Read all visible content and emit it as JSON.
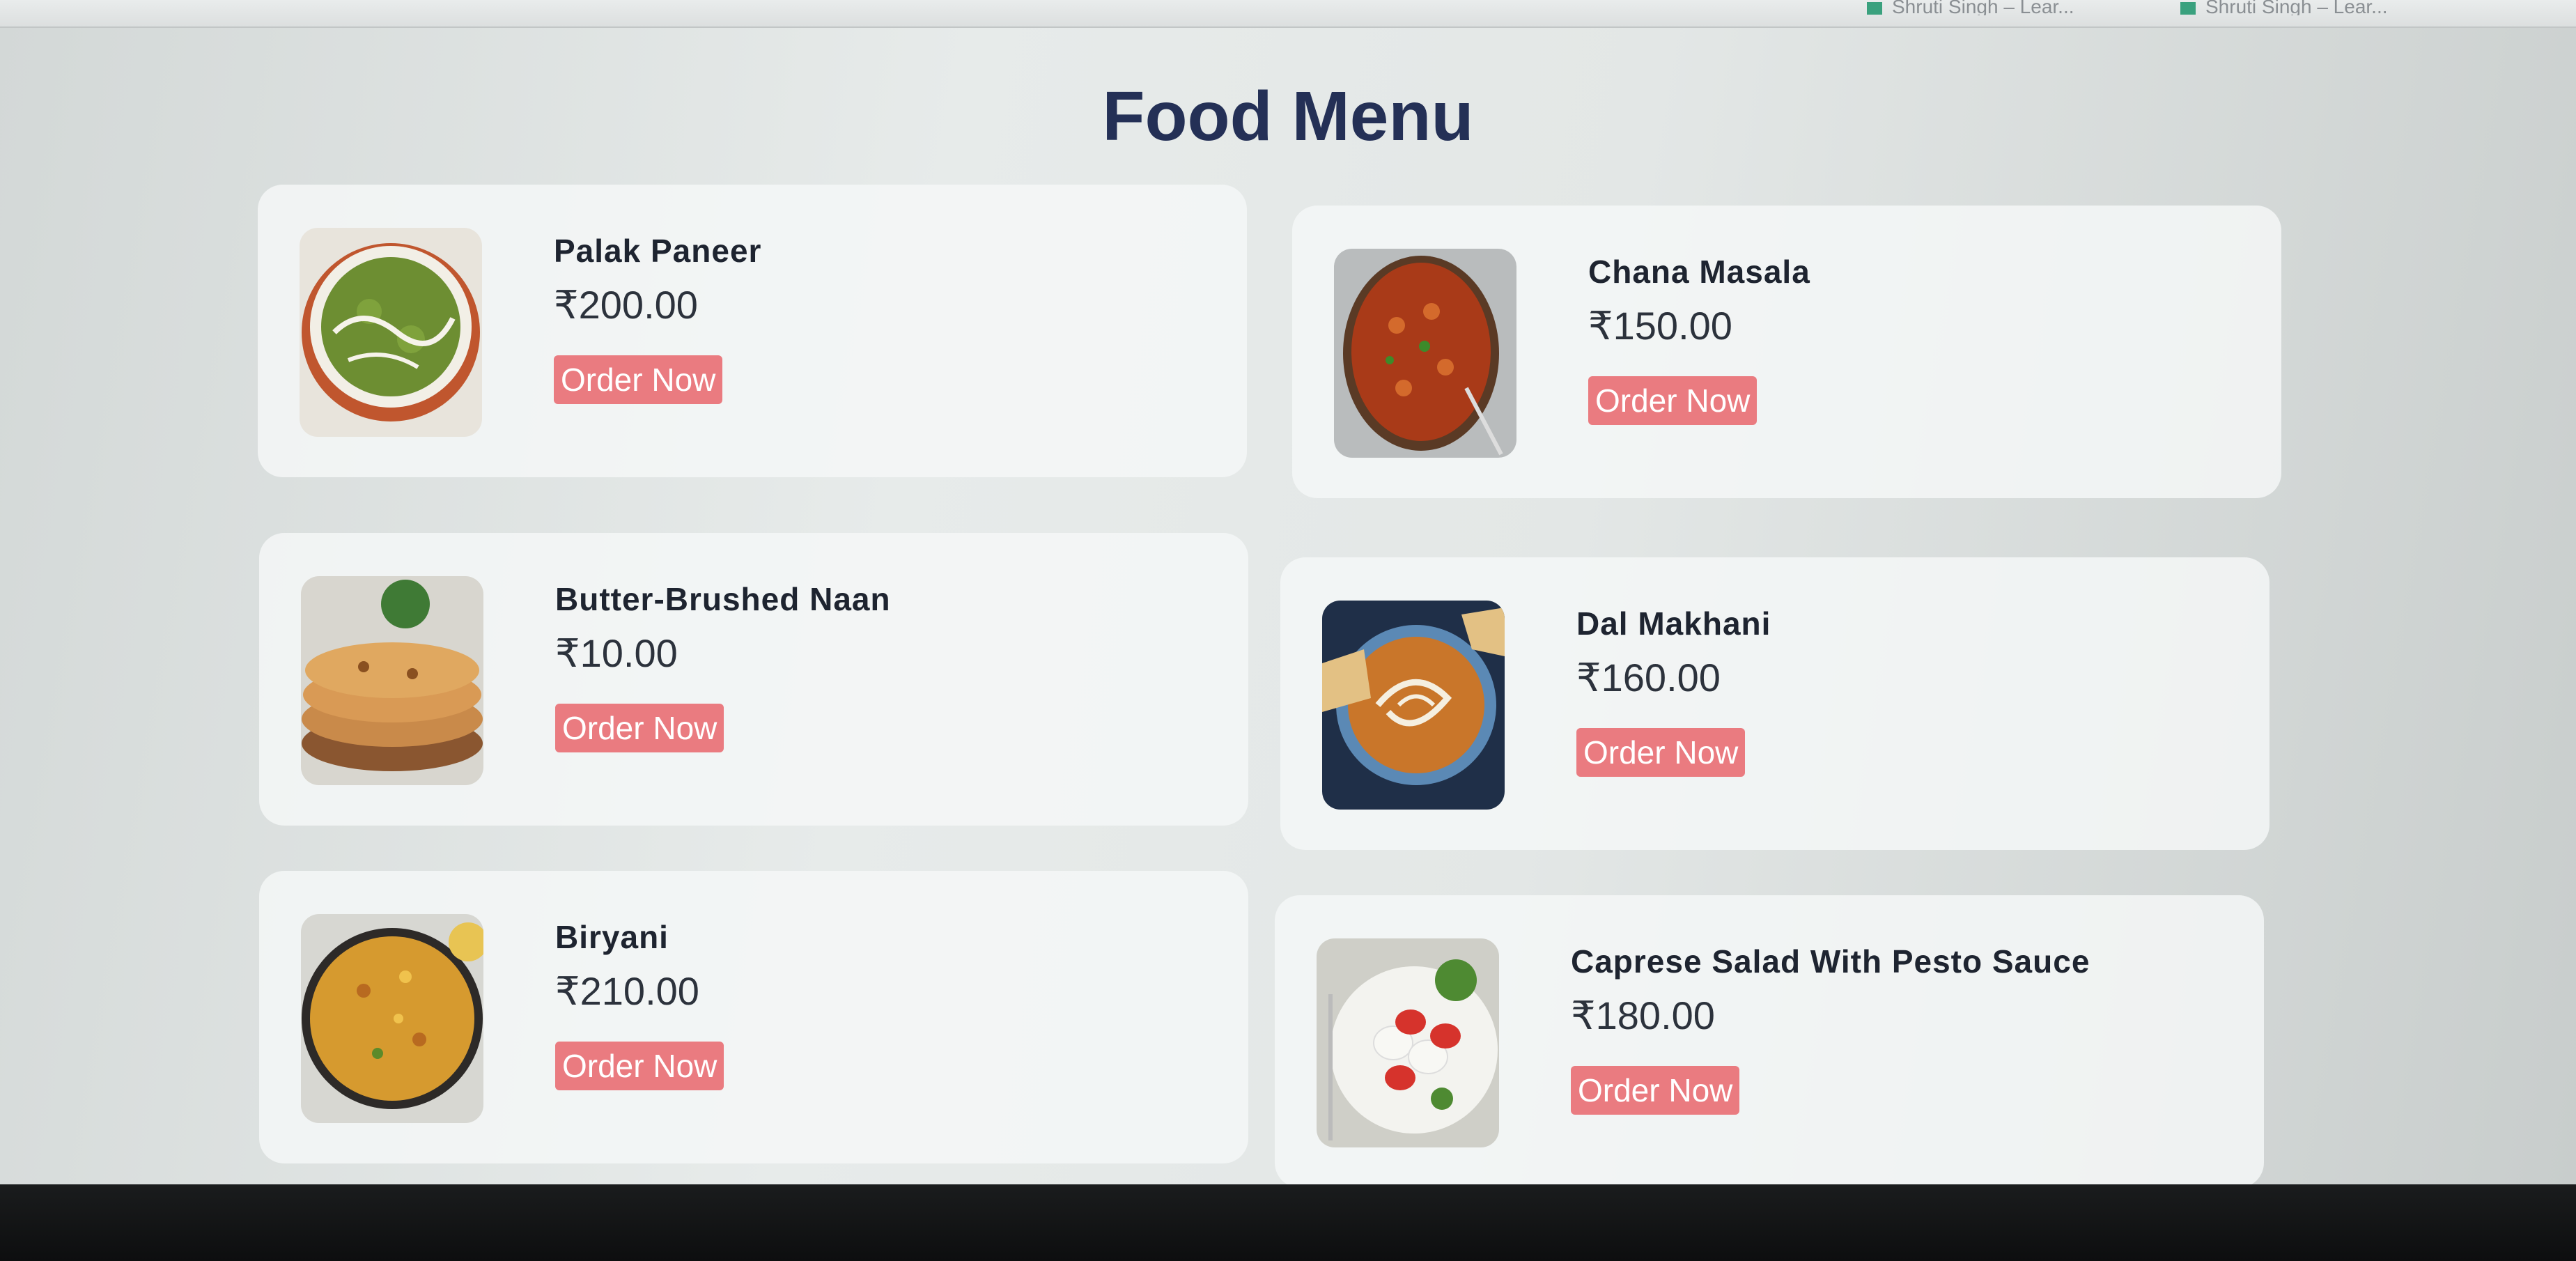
{
  "page": {
    "title": "Food Menu"
  },
  "browser_tabs": [
    {
      "label": "Shruti Singh – Lear..."
    },
    {
      "label": "Shruti Singh – Lear..."
    }
  ],
  "menu_items": [
    {
      "name": "Palak Paneer",
      "price": "₹200.00",
      "button": "Order Now",
      "image": "palak-paneer-image"
    },
    {
      "name": "Chana Masala",
      "price": "₹150.00",
      "button": "Order Now",
      "image": "chana-masala-image"
    },
    {
      "name": "Butter-Brushed Naan",
      "price": "₹10.00",
      "button": "Order Now",
      "image": "naan-image"
    },
    {
      "name": "Dal Makhani",
      "price": "₹160.00",
      "button": "Order Now",
      "image": "dal-makhani-image"
    },
    {
      "name": "Biryani",
      "price": "₹210.00",
      "button": "Order Now",
      "image": "biryani-image"
    },
    {
      "name": "Caprese Salad With Pesto Sauce",
      "price": "₹180.00",
      "button": "Order Now",
      "image": "caprese-salad-image"
    }
  ],
  "colors": {
    "title": "#243056",
    "button": "#ea7b80",
    "card": "#f5f7f7"
  }
}
